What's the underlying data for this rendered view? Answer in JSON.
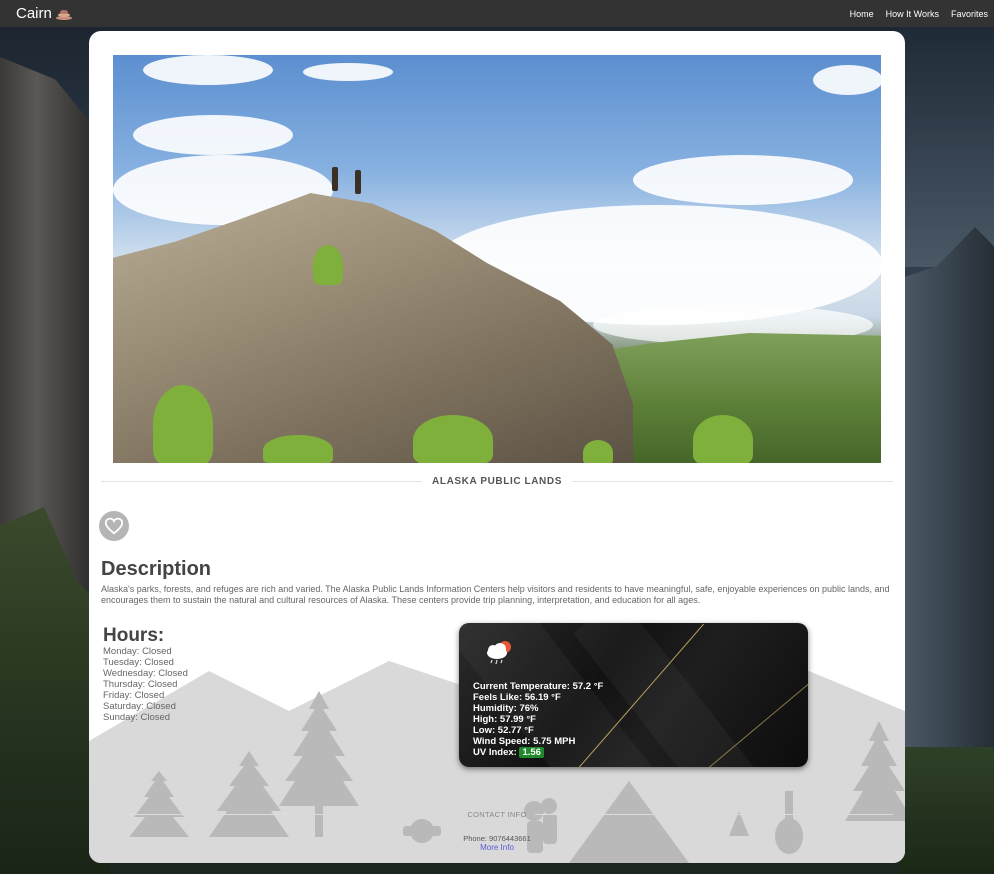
{
  "nav": {
    "brand": "Cairn",
    "links": [
      "Home",
      "How It Works",
      "Favorites"
    ]
  },
  "place": {
    "title": "ALASKA PUBLIC LANDS",
    "favorite_icon": "heart-icon"
  },
  "description": {
    "heading": "Description",
    "text": "Alaska's parks, forests, and refuges are rich and varied. The Alaska Public Lands Information Centers help visitors and residents to have meaningful, safe, enjoyable experiences on public lands, and encourages them to sustain the natural and cultural resources of Alaska. These centers provide trip planning, interpretation, and education for all ages."
  },
  "hours": {
    "heading": "Hours:",
    "days": [
      "Monday: Closed",
      "Tuesday: Closed",
      "Wednesday: Closed",
      "Thursday: Closed",
      "Friday: Closed",
      "Saturday: Closed",
      "Sunday: Closed"
    ]
  },
  "weather": {
    "icon": "rain-cloud-sun-icon",
    "current_temperature": "Current Temperature: 57.2 °F",
    "feels_like": "Feels Like: 56.19 °F",
    "humidity": "Humidity: 76%",
    "high": "High: 57.99 °F",
    "low": "Low: 52.77 °F",
    "wind_speed": "Wind Speed: 5.75 MPH",
    "uv_label": "UV Index:",
    "uv_value": "1.56",
    "uv_color": "#1e8a2a"
  },
  "contact": {
    "heading": "CONTACT INFO",
    "phone": "Phone: 9076443661",
    "more_info": "More Info"
  }
}
